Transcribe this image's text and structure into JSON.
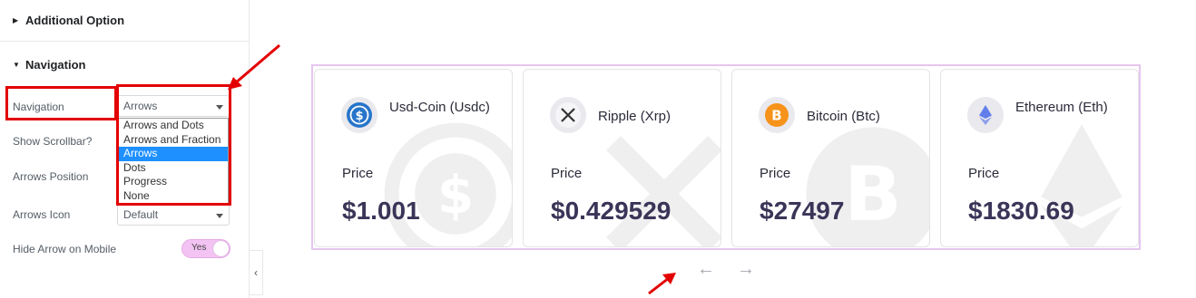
{
  "panel": {
    "additional_option": "Additional Option",
    "navigation_section": "Navigation",
    "rows": {
      "navigation_label": "Navigation",
      "navigation_value": "Arrows",
      "scrollbar_label": "Show Scrollbar?",
      "arrows_position_label": "Arrows Position",
      "arrows_icon_label": "Arrows Icon",
      "arrows_icon_value": "Default",
      "hide_arrow_label": "Hide Arrow on Mobile",
      "hide_arrow_toggle": "Yes"
    },
    "navigation_options": [
      "Arrows and Dots",
      "Arrows and Fraction",
      "Arrows",
      "Dots",
      "Progress",
      "None"
    ],
    "selected_option": "Arrows"
  },
  "colors": {
    "annotation": "#e30000",
    "selected_option": "#1e90ff",
    "carousel_border": "#e6c6ee",
    "price_text": "#3a3558",
    "toggle_on": "#f3c4f3"
  },
  "cards": [
    {
      "name": "Usd-Coin (Usdc)",
      "price_label": "Price",
      "price": "$1.001",
      "icon": "usdc-icon"
    },
    {
      "name": "Ripple (Xrp)",
      "price_label": "Price",
      "price": "$0.429529",
      "icon": "xrp-icon"
    },
    {
      "name": "Bitcoin (Btc)",
      "price_label": "Price",
      "price": "$27497",
      "icon": "bitcoin-icon"
    },
    {
      "name": "Ethereum (Eth)",
      "price_label": "Price",
      "price": "$1830.69",
      "icon": "ethereum-icon"
    }
  ],
  "carousel_nav": {
    "prev": "←",
    "next": "→"
  },
  "collapse": "‹"
}
